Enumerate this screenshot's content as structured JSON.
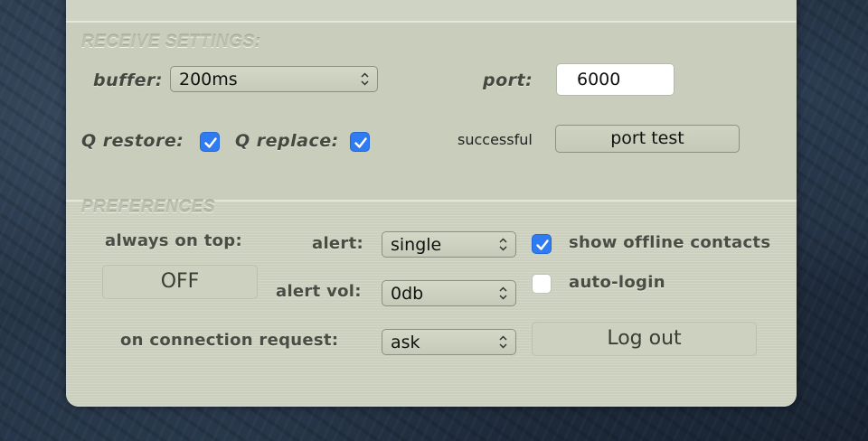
{
  "receive": {
    "title": "RECEIVE SETTINGS:",
    "buffer_label": "buffer:",
    "buffer_value": "200ms",
    "port_label": "port:",
    "port_value": "6000",
    "q_restore_label": "Q restore:",
    "q_restore_checked": true,
    "q_replace_label": "Q replace:",
    "q_replace_checked": true,
    "port_status": "successful",
    "port_test_label": "port test"
  },
  "preferences": {
    "title": "PREFERENCES",
    "always_on_top_label": "always on top:",
    "always_on_top_value": "OFF",
    "alert_label": "alert:",
    "alert_value": "single",
    "alert_vol_label": "alert vol:",
    "alert_vol_value": "0db",
    "connection_request_label": "on connection request:",
    "connection_request_value": "ask",
    "show_offline_label": "show offline contacts",
    "show_offline_checked": true,
    "auto_login_label": "auto-login",
    "auto_login_checked": false,
    "logout_label": "Log out"
  },
  "icons": {
    "select_arrows": "chevron-up-down-icon",
    "checkmark": "checkmark-icon"
  },
  "colors": {
    "checkbox_accent": "#2f7bf2",
    "panel_background": "#ccd0bf"
  }
}
